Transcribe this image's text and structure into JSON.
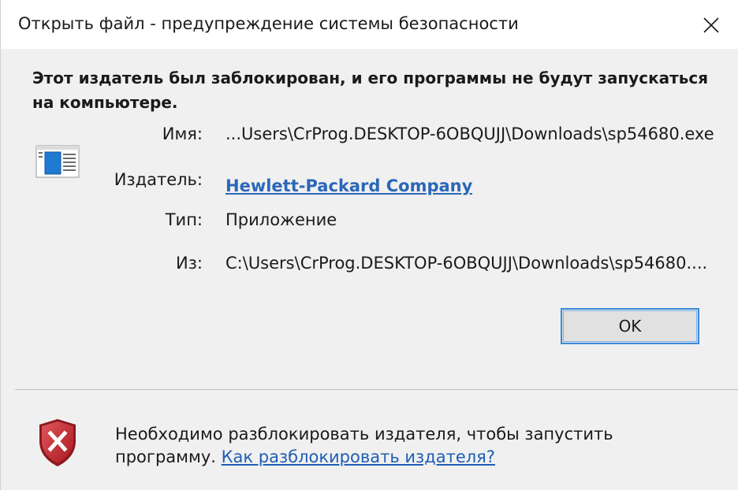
{
  "window": {
    "title": "Открыть файл - предупреждение системы безопасности",
    "close_icon": "close-icon"
  },
  "headline": "Этот издатель был заблокирован, и его программы не будут запускаться на компьютере.",
  "file_icon": "application-file-icon",
  "details": {
    "name_label": "Имя:",
    "name_value": "...Users\\CrProg.DESKTOP-6OBQUJJ\\Downloads\\sp54680.exe",
    "publisher_label": "Издатель:",
    "publisher_value": "Hewlett-Packard Company",
    "type_label": "Тип:",
    "type_value": "Приложение",
    "from_label": "Из:",
    "from_value": "C:\\Users\\CrProg.DESKTOP-6OBQUJJ\\Downloads\\sp54680...."
  },
  "buttons": {
    "ok_label": "OK"
  },
  "footer": {
    "shield_icon": "security-shield-error-icon",
    "text": "Необходимо разблокировать издателя, чтобы запустить программу.",
    "link_text": "Как разблокировать издателя?"
  },
  "colors": {
    "link": "#1e5eb5",
    "button_border": "#3c8ad8",
    "shield_red": "#c4262e"
  }
}
